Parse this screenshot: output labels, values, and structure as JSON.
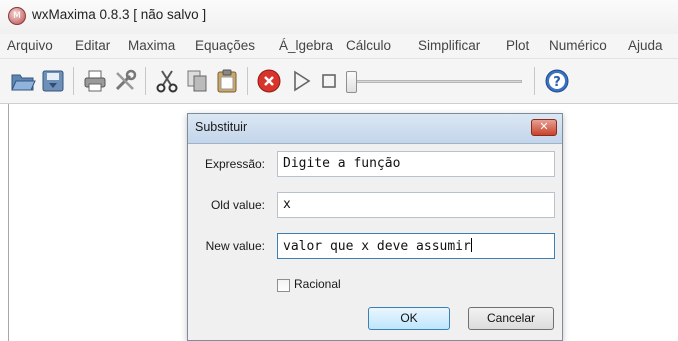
{
  "window": {
    "title": "wxMaxima 0.8.3 [ não salvo ]"
  },
  "menu": [
    "Arquivo",
    "Editar",
    "Maxima",
    "Equações",
    "Á_lgebra",
    "Cálculo",
    "Simplificar",
    "Plot",
    "Numérico",
    "Ajuda"
  ],
  "toolbar": {
    "icons": [
      "open-folder-icon",
      "save-icon",
      "print-icon",
      "preferences-icon",
      "cut-icon",
      "copy-icon",
      "paste-icon",
      "interrupt-icon",
      "play-icon",
      "stop-icon",
      "animation-slider",
      "help-icon"
    ],
    "slider_level": 0
  },
  "dialog": {
    "title": "Substituir",
    "close_glyph": "✕",
    "expression_label": "Expressão:",
    "expression_value": "Digite a função",
    "old_label": "Old value:",
    "old_value": "x",
    "new_label": "New value:",
    "new_value": "valor que x deve assumir",
    "rational_label": "Racional",
    "rational_checked": false,
    "ok_label": "OK",
    "cancel_label": "Cancelar"
  },
  "colors": {
    "close_button": "#c7432c",
    "focus_border": "#3c7fb1",
    "stop_icon": "#d9342b"
  }
}
